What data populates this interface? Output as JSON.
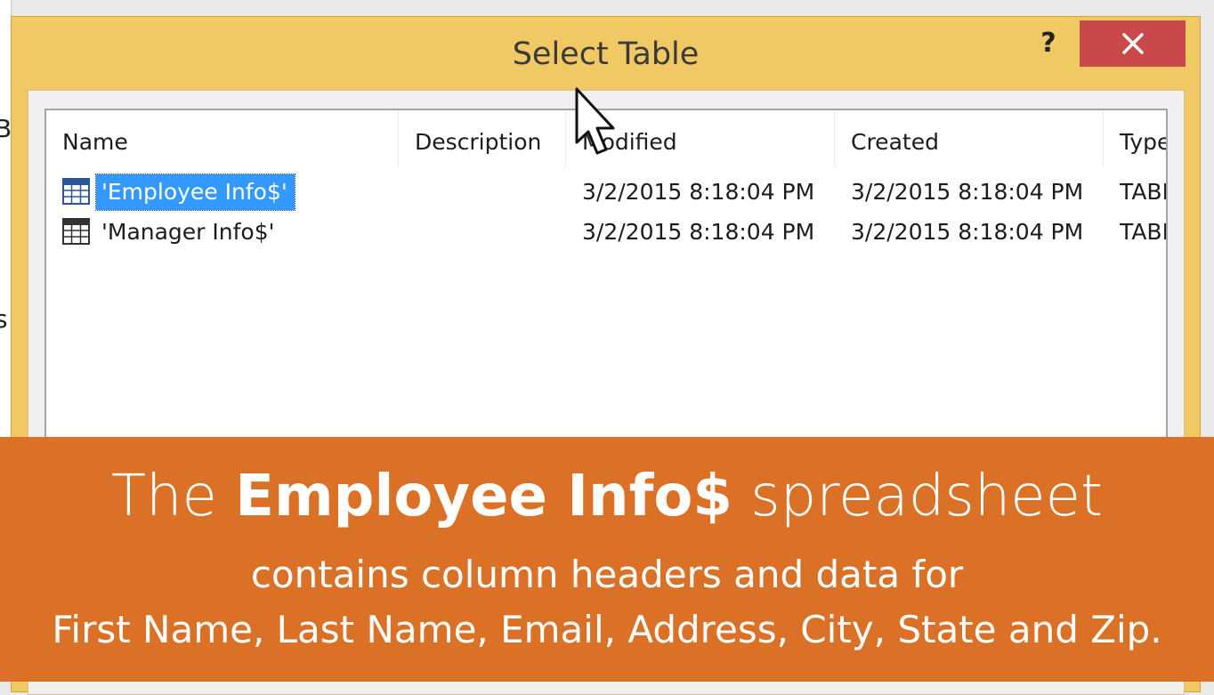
{
  "dialog": {
    "title": "Select Table",
    "help_label": "?",
    "close_label": "×"
  },
  "table": {
    "columns": [
      "Name",
      "Description",
      "Modified",
      "Created",
      "Type"
    ],
    "rows": [
      {
        "name": "'Employee Info$'",
        "description": "",
        "modified": "3/2/2015 8:18:04 PM",
        "created": "3/2/2015 8:18:04 PM",
        "type": "TABLE",
        "selected": true
      },
      {
        "name": "'Manager Info$'",
        "description": "",
        "modified": "3/2/2015 8:18:04 PM",
        "created": "3/2/2015 8:18:04 PM",
        "type": "TABLE",
        "selected": false
      }
    ]
  },
  "banner": {
    "line1_pre": "The ",
    "line1_bold": "Employee Info$",
    "line1_post": " spreadsheet",
    "line2": "contains column headers and data for",
    "line3": "First Name, Last Name, Email, Address, City, State and Zip."
  },
  "colors": {
    "title_bar": "#f0c864",
    "close_button": "#c9494a",
    "selection": "#3399ff",
    "banner": "#db7027"
  },
  "icons": {
    "row_icon": "table-grid-icon",
    "close": "close-icon",
    "help": "help-icon",
    "cursor": "mouse-pointer-icon"
  }
}
